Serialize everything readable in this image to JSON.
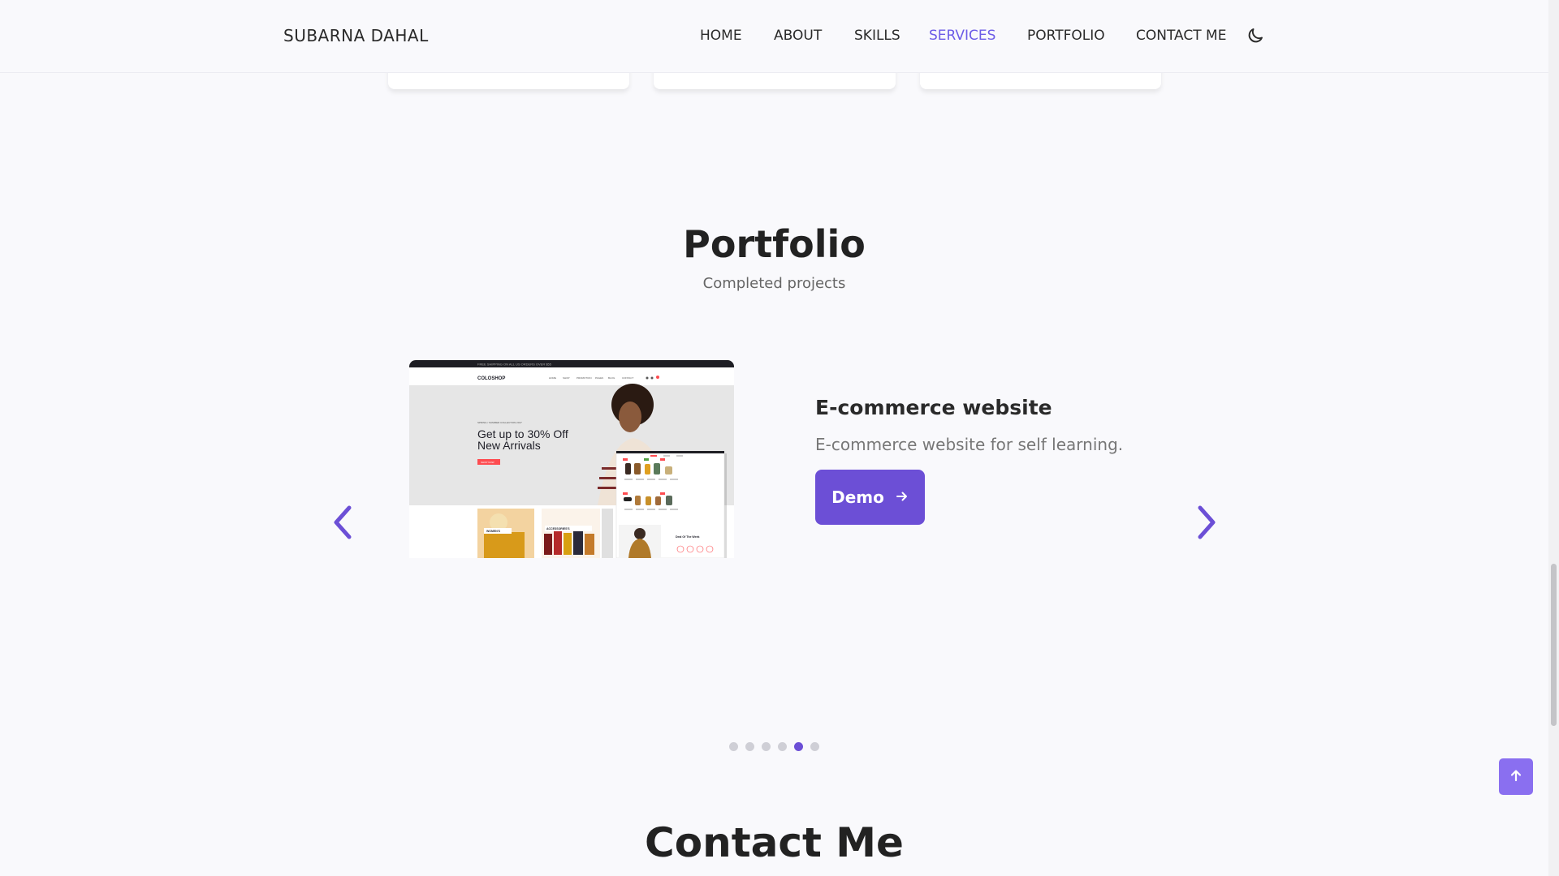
{
  "header": {
    "logo": "SUBARNA DAHAL",
    "nav": [
      {
        "label": "HOME",
        "active": false
      },
      {
        "label": "ABOUT",
        "active": false
      },
      {
        "label": "SKILLS",
        "active": false
      },
      {
        "label": "SERVICES",
        "active": true
      },
      {
        "label": "PORTFOLIO",
        "active": false
      },
      {
        "label": "CONTACT ME",
        "active": false
      }
    ],
    "theme_icon": "moon-icon"
  },
  "portfolio": {
    "title": "Portfolio",
    "subtitle": "Completed projects",
    "project": {
      "title": "E-commerce website",
      "description": "E-commerce website for self learning.",
      "demo_label": "Demo",
      "demo_icon": "arrow-right-icon",
      "preview": {
        "topbar_text": "FREE SHIPPING ON ALL US ORDERS OVER $55",
        "brand": "COLOSHOP",
        "menu": [
          "HOME",
          "SHOP",
          "PROMOTION",
          "PAGES",
          "BLOG",
          "CONTACT"
        ],
        "kicker": "SPRING / SUMMER COLLECTION 2017",
        "headline": "Get up to 30% Off New Arrivals",
        "cta": "SHOP NOW",
        "tiles": [
          "WOMEN'S",
          "ACCESSORIES'S"
        ],
        "deal": "Deal Of The Week"
      }
    },
    "slides": 6,
    "active_slide": 5,
    "prev_icon": "chevron-left-icon",
    "next_icon": "chevron-right-icon"
  },
  "contact": {
    "title": "Contact Me"
  },
  "scroll_top_icon": "arrow-up-icon",
  "colors": {
    "accent": "#6c4fd6",
    "background": "#f9f9fc"
  }
}
